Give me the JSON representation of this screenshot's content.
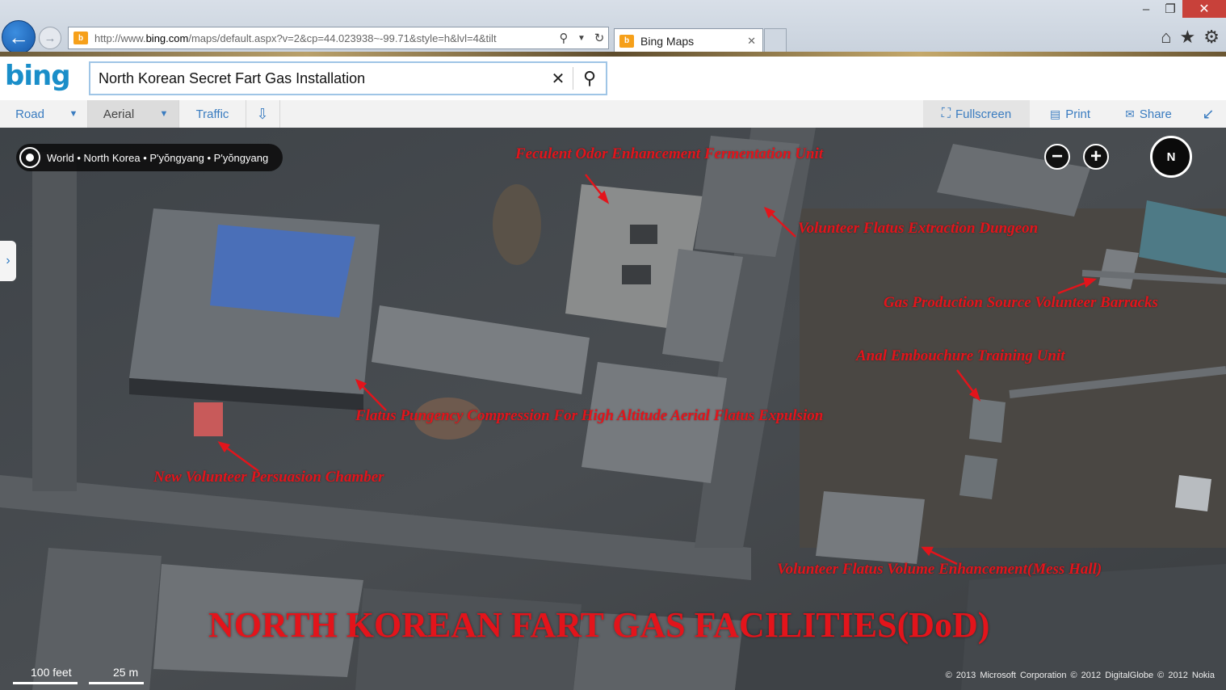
{
  "browser": {
    "url": "http://www.bing.com/maps/default.aspx?v=2&cp=44.023938~-99.71&style=h&lvl=4&tilt",
    "url_domain": "bing.com",
    "url_prefix": "http://www.",
    "url_suffix": "/maps/default.aspx?v=2&cp=44.023938~-99.71&style=h&lvl=4&tilt",
    "tab_title": "Bing Maps",
    "icons": [
      "back-arrow-icon",
      "forward-arrow-icon",
      "search-icon",
      "refresh-icon",
      "home-icon",
      "star-icon",
      "gear-icon"
    ]
  },
  "bing": {
    "logo": "bing",
    "search_value": "North Korean Secret Fart Gas Installation"
  },
  "toolbar": {
    "road": "Road",
    "aerial": "Aerial",
    "traffic": "Traffic",
    "fullscreen": "Fullscreen",
    "print": "Print",
    "share": "Share"
  },
  "map": {
    "breadcrumb": "World • North Korea • P'yŏngyang • P'yŏngyang",
    "compass_label": "N",
    "annotations": {
      "a1": "Feculent Odor Enhancement Fermentation Unit",
      "a2": "Volunteer Flatus Extraction Dungeon",
      "a3": "Gas Production Source Volunteer Barracks",
      "a4": "Anal Embouchure Training Unit",
      "a5": "Flatus Pungency Compression For High Altitude Aerial Flatus Expulsion",
      "a6": "New Volunteer Persuasion Chamber",
      "a7": "Volunteer Flatus Volume Enhancement(Mess Hall)"
    },
    "title": "NORTH KOREAN FART GAS FACILITIES(DoD)",
    "scale_feet": "100 feet",
    "scale_meters": "25 m",
    "copyright": "© 2013 Microsoft Corporation   © 2012 DigitalGlobe   © 2012 Nokia"
  },
  "colors": {
    "annotation_red": "#e3141b",
    "bing_blue": "#1a8ec9",
    "link_blue": "#3a7cc0"
  }
}
